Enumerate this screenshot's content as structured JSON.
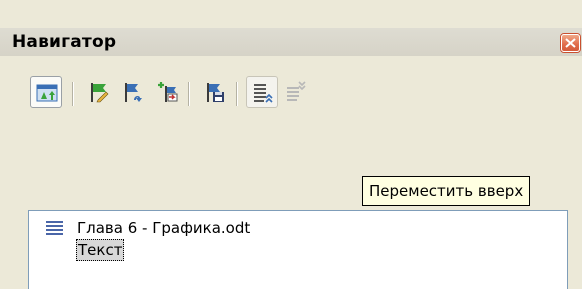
{
  "window": {
    "title": "Навигатор"
  },
  "toolbar": {
    "buttons": [
      {
        "name": "navigation-toggle",
        "icon": "navigator-toggle-icon",
        "state": "pressed"
      },
      {
        "name": "set-reminder",
        "icon": "reminder-flag-icon",
        "state": "normal"
      },
      {
        "name": "drag-mode",
        "icon": "drag-mode-icon",
        "state": "normal"
      },
      {
        "name": "insert",
        "icon": "insert-icon",
        "state": "normal"
      },
      {
        "name": "save-as",
        "icon": "save-flag-icon",
        "state": "normal"
      },
      {
        "name": "move-up",
        "icon": "move-up-icon",
        "state": "hover"
      },
      {
        "name": "move-down",
        "icon": "move-down-icon",
        "state": "disabled"
      }
    ]
  },
  "tooltip": {
    "text": "Переместить вверх"
  },
  "tree": {
    "document": "Глава 6 - Графика.odt",
    "child": "Текст"
  },
  "colors": {
    "background": "#ece9d8",
    "close_button": "#e06b4a",
    "tooltip_bg": "#ffffe1",
    "tree_border": "#7f9db9",
    "flag_green": "#3aa33a",
    "flag_blue": "#3a6fb5"
  }
}
